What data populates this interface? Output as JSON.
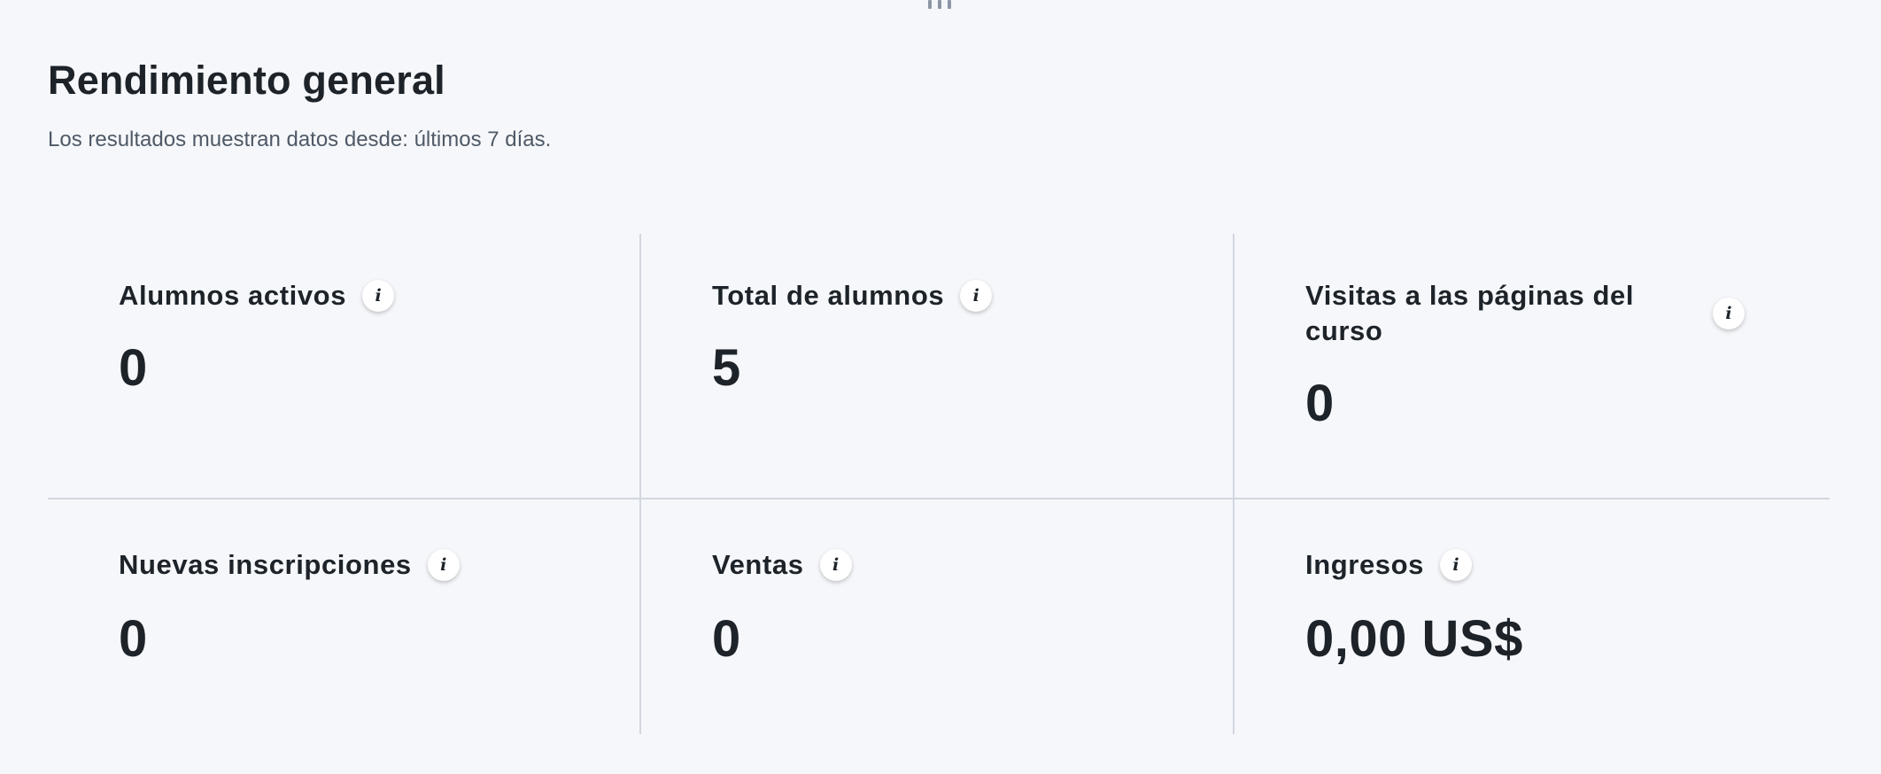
{
  "header": {
    "title": "Rendimiento general",
    "subtitle": "Los resultados muestran datos desde: últimos 7 días."
  },
  "info_icon_glyph": "i",
  "metrics": [
    {
      "label": "Alumnos activos",
      "value": "0",
      "icon": "info-icon"
    },
    {
      "label": "Total de alumnos",
      "value": "5",
      "icon": "info-icon"
    },
    {
      "label": "Visitas a las páginas del curso",
      "value": "0",
      "icon": "info-icon"
    },
    {
      "label": "Nuevas inscripciones",
      "value": "0",
      "icon": "info-icon"
    },
    {
      "label": "Ventas",
      "value": "0",
      "icon": "info-icon"
    },
    {
      "label": "Ingresos",
      "value": "0,00 US$",
      "icon": "info-icon"
    }
  ],
  "colors": {
    "background": "#f5f7fa",
    "text": "#1d2329",
    "muted_text": "#4f5966",
    "divider": "#d1d7df",
    "handle": "#8d96a5"
  }
}
